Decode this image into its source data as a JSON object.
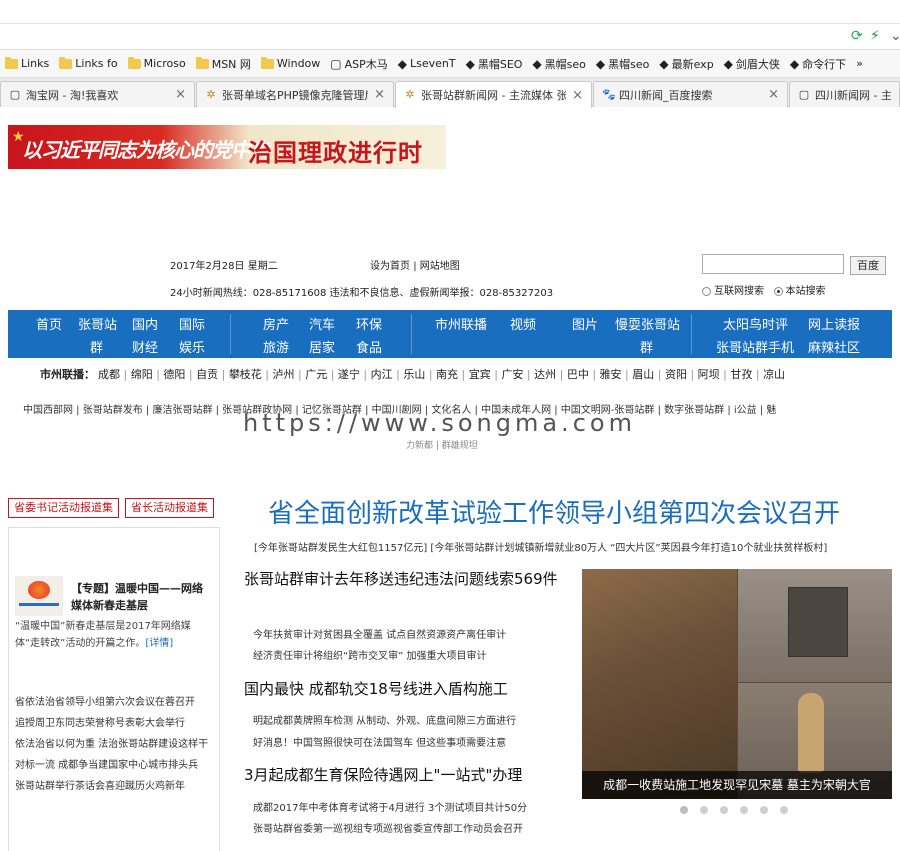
{
  "browser": {
    "favorites": [
      {
        "label": "Links",
        "icon": "folder-icon"
      },
      {
        "label": "Links fo",
        "icon": "folder-icon"
      },
      {
        "label": "Microso",
        "icon": "folder-icon"
      },
      {
        "label": "MSN 网",
        "icon": "folder-icon"
      },
      {
        "label": "Window",
        "icon": "folder-icon"
      },
      {
        "label": "ASP木马",
        "icon": "page-icon"
      },
      {
        "label": "LsevenT",
        "icon": "bookmark-icon"
      },
      {
        "label": "黑帽SEO",
        "icon": "bookmark-icon"
      },
      {
        "label": "黑帽seo",
        "icon": "bookmark-icon"
      },
      {
        "label": "黑帽seo",
        "icon": "bookmark-icon"
      },
      {
        "label": "最新exp",
        "icon": "bookmark-icon"
      },
      {
        "label": "剑眉大侠",
        "icon": "bookmark-icon"
      },
      {
        "label": "命令行下",
        "icon": "bookmark-icon"
      }
    ],
    "more_label": "»",
    "tabs": [
      {
        "label": "淘宝网 - 淘!我喜欢",
        "close": "×"
      },
      {
        "label": "张哥单域名PHP镜像克隆管理后",
        "close": "×"
      },
      {
        "label": "张哥站群新闻网 - 主流媒体 张哥",
        "close": "×"
      },
      {
        "label": "四川新闻_百度搜索",
        "close": "×"
      },
      {
        "label": "四川新闻网 - 主流",
        "close": ""
      }
    ]
  },
  "banner": {
    "left_text": "以习近平同志为核心的党中央",
    "right_text": "治国理政进行时"
  },
  "header": {
    "date": "2017年2月28日 星期二",
    "set_home": "设为首页",
    "site_map": "网站地图",
    "sep": "|",
    "hotline": "24小时新闻热线：028-85171608 违法和不良信息、虚假新闻举报：028-85327203",
    "search_button": "百度",
    "radio_web": "互联网搜索",
    "radio_site": "本站搜索"
  },
  "nav": {
    "col1": [
      [
        "首页",
        "张哥站",
        "国内",
        "国际"
      ],
      [
        "群",
        "财经",
        "娱乐"
      ]
    ],
    "col2": [
      [
        "房产",
        "汽车",
        "环保"
      ],
      [
        "旅游",
        "居家",
        "食品"
      ]
    ],
    "col3": [
      "市州联播",
      "视频",
      "图片",
      "慢耍张哥站",
      "群"
    ],
    "col4": [
      [
        "太阳鸟时评",
        "网上读报"
      ],
      [
        "张哥站群手机",
        "麻辣社区"
      ]
    ]
  },
  "cities": {
    "label": "市州联播：",
    "items": [
      "成都",
      "绵阳",
      "德阳",
      "自贡",
      "攀枝花",
      "泸州",
      "广元",
      "遂宁",
      "内江",
      "乐山",
      "南充",
      "宜宾",
      "广安",
      "达州",
      "巴中",
      "雅安",
      "眉山",
      "资阳",
      "阿坝",
      "甘孜",
      "凉山"
    ]
  },
  "links_row": "中国西部网 | 张哥站群发布 | 廉洁张哥站群 | 张哥站群政协网 | 记忆张哥站群 | 中国川剧网 | 文化名人 | 中国未成年人网 | 中国文明网-张哥站群 | 数字张哥站群 | i公益 | 魅",
  "watermark": "https://www.songma.com",
  "watermark_below": "力新都 | 群雄规坦",
  "left": {
    "btn1": "省委书记活动报道集",
    "btn2": "省长活动报道集",
    "feature_title": "【专题】温暖中国——网络媒体新春走基层",
    "feature_body": "“温暖中国”新春走基层是2017年网络媒体“走转改”活动的开篇之作。",
    "feature_more": "[详情]",
    "list": [
      "省依法治省领导小组第六次会议在蓉召开",
      "追授周卫东同志荣誉称号表彰大会举行",
      "依法治省以何为重  法治张哥站群建设这样干",
      "对标一流  成都争当建国家中心城市排头兵",
      "张哥站群举行茶话会喜迎蹴历火鸡新年"
    ]
  },
  "main": {
    "headline": "省全面创新改革试验工作领导小组第四次会议召开",
    "subline": "[今年张哥站群发民生大红包1157亿元] [今年张哥站群计划城镇新增就业80万人  “四大片区”荚因县今年打造10个就业扶贫样板村]",
    "stories": [
      {
        "title": "张哥站群审计去年移送违纪违法问题线索569件",
        "lines": [
          "今年扶贫审计对贫困县全覆盖    试点自然资源资产离任审计",
          "经济责任审计将组织“跨市交叉审”    加强重大项目审计"
        ]
      },
      {
        "title": "国内最快 成都轨交18号线进入盾构施工",
        "lines": [
          "明起成都黄牌照车检测  从制动、外观、底盘间隙三方面进行",
          "好消息！中国驾照很快可在法国驾车  但这些事项需要注意"
        ]
      },
      {
        "title": "3月起成都生育保险待遇网上\"一站式\"办理",
        "lines": [
          "成都2017年中考体育考试将于4月进行  3个测试项目共计50分",
          "张哥站群省委第一巡视组专项巡视省委宣传部工作动员会召开"
        ]
      }
    ],
    "photo_caption": "成都一收费站施工地发现罕见宋墓 墓主为宋朝大官",
    "carousel_count": 6,
    "carousel_active": 0
  }
}
